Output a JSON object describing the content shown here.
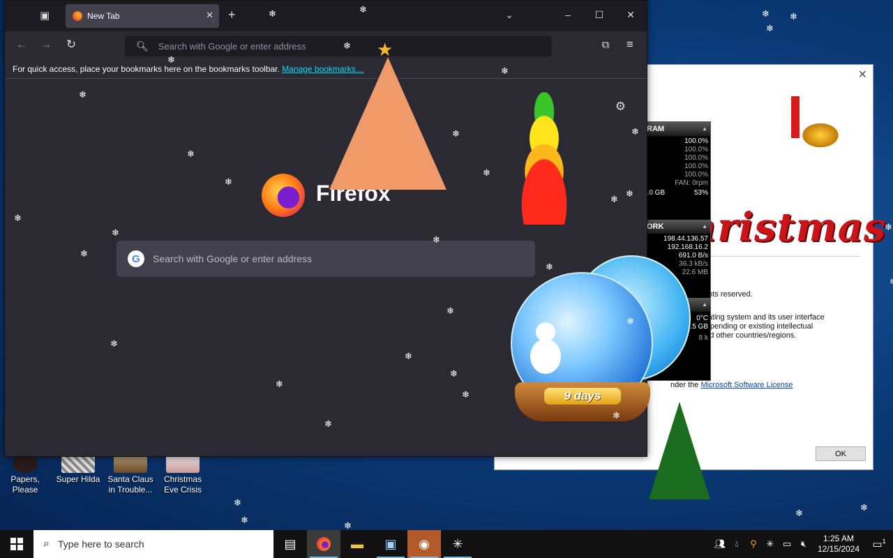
{
  "browser": {
    "tab_title": "New Tab",
    "url_placeholder": "Search with Google or enter address",
    "bookmarks_hint": "For quick access, place your bookmarks here on the bookmarks toolbar.",
    "manage_bookmarks": "Manage bookmarks…",
    "brand_word": "Firefox",
    "content_search_placeholder": "Search with Google or enter address"
  },
  "desktop_icons": [
    {
      "label": "Papers,\nPlease"
    },
    {
      "label": "Super Hilda"
    },
    {
      "label": "Santa Claus in Trouble..."
    },
    {
      "label": "Christmas Eve Crisis"
    }
  ],
  "about_dialog": {
    "title_art": "Christmas",
    "rights_text": "ghts reserved.",
    "os_line1": "erating system and its user interface",
    "os_line2": "er pending or existing intellectual",
    "os_line3": "and other countries/regions.",
    "license_prefix": "nder the",
    "license_link": "Microsoft Software License",
    "ok_button": "OK"
  },
  "gauges": {
    "ram_header": "RAM",
    "ram_values": [
      "100.0%",
      "100.0%",
      "100.0%",
      "100.0%",
      "100.0%"
    ],
    "fan": "FAN: 0rpm",
    "disk": "3.0 GB",
    "disk_pct": "53%",
    "network_header": "ORK",
    "net_values": [
      "198.44.136.57",
      "192.168.16.2",
      "691.0 B/s",
      "36.3 kB/s",
      "22.6 MB"
    ],
    "temp": "0°C",
    "storage": "9.5 GB",
    "misc": "8 k"
  },
  "snow_globe": {
    "countdown": "9 days"
  },
  "taskbar": {
    "search_placeholder": "Type here to search",
    "time": "1:25 AM",
    "date": "12/15/2024",
    "notification_count": "1"
  }
}
